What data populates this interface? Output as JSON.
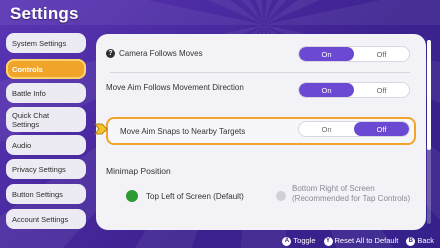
{
  "title": "Settings",
  "sidebar": {
    "items": [
      {
        "label": "System Settings"
      },
      {
        "label": "Controls"
      },
      {
        "label": "Battle Info"
      },
      {
        "label": "Quick Chat Settings"
      },
      {
        "label": "Audio"
      },
      {
        "label": "Privacy Settings"
      },
      {
        "label": "Button Settings"
      },
      {
        "label": "Account Settings"
      }
    ],
    "selected": "Controls"
  },
  "settings": {
    "camera": {
      "label": "Camera Follows Moves",
      "on": "On",
      "off": "Off",
      "value": "On",
      "help_icon": "question-icon"
    },
    "aim_follows": {
      "label": "Move Aim Follows Movement Direction",
      "on": "On",
      "off": "Off",
      "value": "On"
    },
    "aim_snaps": {
      "label": "Move Aim Snaps to Nearby Targets",
      "on": "On",
      "off": "Off",
      "value": "Off"
    },
    "minimap": {
      "heading": "Minimap Position",
      "option1": "Top Left of Screen (Default)",
      "option2": "Bottom Right of Screen (Recommended for Tap Controls)",
      "selected": "Top Left of Screen (Default)"
    }
  },
  "footer": {
    "toggle_key": "A",
    "toggle": "Toggle",
    "reset_key": "Y",
    "reset": "Reset All to Default",
    "back_key": "B",
    "back": "Back"
  },
  "colors": {
    "accent": "#f0a52a",
    "selected_toggle": "#6b49d2",
    "check": "#2e9a35",
    "background": "#4a2a9e"
  }
}
